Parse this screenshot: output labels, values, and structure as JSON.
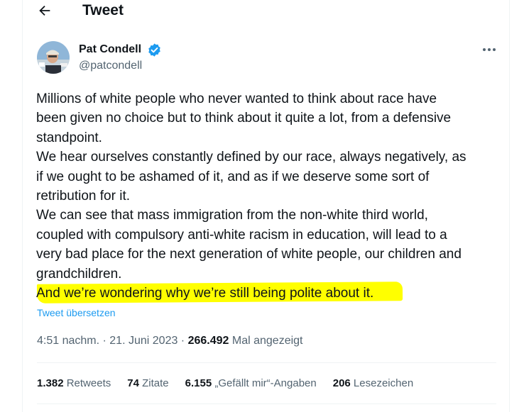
{
  "header": {
    "title": "Tweet"
  },
  "author": {
    "name": "Pat Condell",
    "handle": "@patcondell"
  },
  "tweet": {
    "lines": [
      "Millions of white people who never wanted to think about race have",
      "been given no choice but to think about it quite a lot, from a defensive",
      "standpoint.",
      "We hear ourselves constantly defined by our race, always negatively, as",
      "if we ought to be ashamed of it, and as if we deserve some sort of",
      "retribution for it.",
      "We can see that mass immigration from the non-white third world,",
      "coupled with compulsory anti-white racism in education, will lead to a",
      "very bad place for the next generation of white people, our children and",
      "grandchildren.",
      "And we’re wondering why we’re still being polite about it."
    ],
    "translate_label": "Tweet übersetzen",
    "highlight_color": "#ffff00"
  },
  "meta": {
    "time": "4:51 nachm.",
    "separator": " · ",
    "date": "21. Juni 2023",
    "separator2": " · ",
    "views_count": "266.492",
    "views_label": " Mal angezeigt"
  },
  "stats": {
    "retweets": {
      "count": "1.382",
      "label": " Retweets"
    },
    "quotes": {
      "count": "74",
      "label": " Zitate"
    },
    "likes": {
      "count": "6.155",
      "label": " „Gefällt mir“-Angaben"
    },
    "bookmarks": {
      "count": "206",
      "label": " Lesezeichen"
    }
  },
  "colors": {
    "accent": "#1d9bf0",
    "secondary_text": "#536471",
    "primary_text": "#0f1419"
  },
  "icons": {
    "back": "arrow-left-icon",
    "verified": "verified-badge-icon",
    "more": "more-horizontal-icon"
  }
}
